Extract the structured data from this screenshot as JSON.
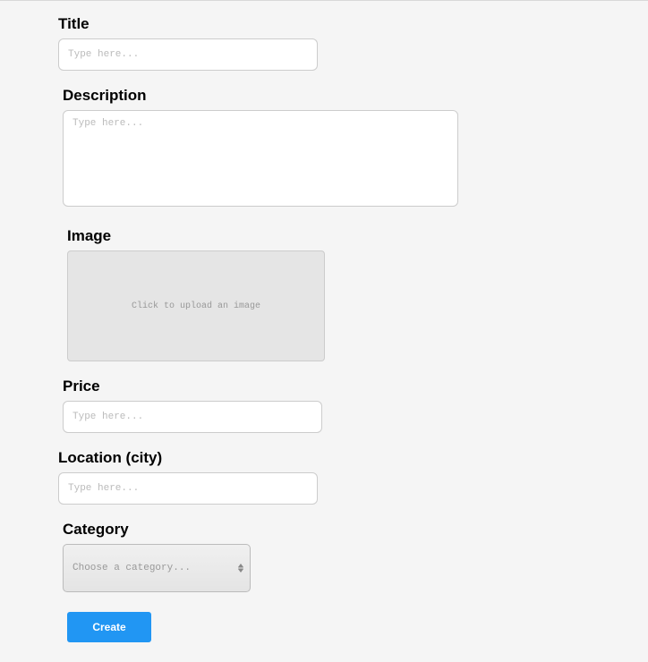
{
  "form": {
    "title": {
      "label": "Title",
      "placeholder": "Type here..."
    },
    "description": {
      "label": "Description",
      "placeholder": "Type here..."
    },
    "image": {
      "label": "Image",
      "upload_text": "Click to upload an image"
    },
    "price": {
      "label": "Price",
      "placeholder": "Type here..."
    },
    "location": {
      "label": "Location (city)",
      "placeholder": "Type here..."
    },
    "category": {
      "label": "Category",
      "placeholder": "Choose a category..."
    },
    "submit": {
      "label": "Create"
    }
  }
}
